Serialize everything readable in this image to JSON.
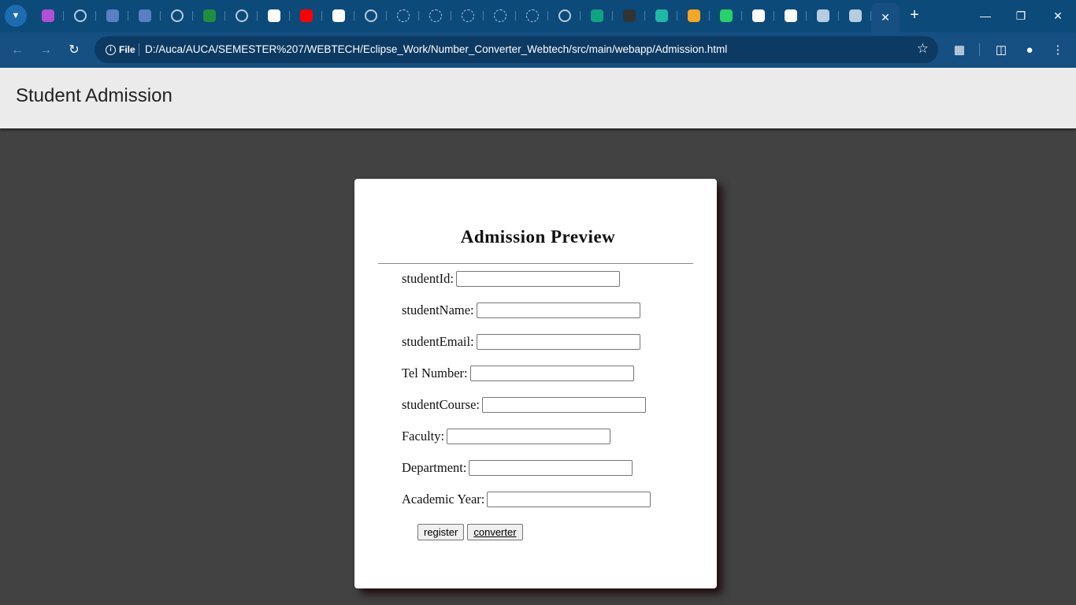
{
  "browser": {
    "tabs": [
      {
        "icon": "copilot-icon",
        "color": "#b14fd6"
      },
      {
        "icon": "web-icon",
        "color": "ring"
      },
      {
        "icon": "form-icon",
        "color": "#5a7fc4"
      },
      {
        "icon": "form-icon",
        "color": "#5a7fc4"
      },
      {
        "icon": "web-icon",
        "color": "ring"
      },
      {
        "icon": "classroom-icon",
        "color": "#1e8e3e"
      },
      {
        "icon": "loading-icon",
        "color": "ring"
      },
      {
        "icon": "chrome-icon",
        "color": "#ffffff"
      },
      {
        "icon": "youtube-icon",
        "color": "#ff0000"
      },
      {
        "icon": "github-icon",
        "color": "#ffffff"
      },
      {
        "icon": "web-icon",
        "color": "ring"
      },
      {
        "icon": "loading-icon",
        "color": "dash"
      },
      {
        "icon": "loading-icon",
        "color": "dash"
      },
      {
        "icon": "loading-icon",
        "color": "dash"
      },
      {
        "icon": "loading-icon",
        "color": "dash"
      },
      {
        "icon": "loading-icon",
        "color": "dash"
      },
      {
        "icon": "loading-icon",
        "color": "ring"
      },
      {
        "icon": "chatgpt-icon",
        "color": "#10a37f"
      },
      {
        "icon": "web-icon",
        "color": "#333333"
      },
      {
        "icon": "docs-icon",
        "color": "#1fb8a6"
      },
      {
        "icon": "search-icon",
        "color": "#f5a623"
      },
      {
        "icon": "whatsapp-icon",
        "color": "#25d366"
      },
      {
        "icon": "google-icon",
        "color": "#ffffff"
      },
      {
        "icon": "chrome-icon",
        "color": "#ffffff"
      },
      {
        "icon": "globe-icon",
        "color": "#b8cce0"
      },
      {
        "icon": "globe-icon",
        "color": "#b8cce0"
      }
    ],
    "site_chip_label": "File",
    "url": "D:/Auca/AUCA/SEMESTER%207/WEBTECH/Eclipse_Work/Number_Converter_Webtech/src/main/webapp/Admission.html",
    "colors": {
      "tabstrip": "#0c4a7a",
      "toolbar": "#164f82"
    }
  },
  "header": {
    "title": "Student Admission"
  },
  "form": {
    "heading": "Admission Preview",
    "fields": [
      {
        "label": "studentId:",
        "value": ""
      },
      {
        "label": "studentName:",
        "value": ""
      },
      {
        "label": "studentEmail:",
        "value": ""
      },
      {
        "label": "Tel Number:",
        "value": ""
      },
      {
        "label": "studentCourse:",
        "value": ""
      },
      {
        "label": "Faculty:",
        "value": ""
      },
      {
        "label": "Department:",
        "value": ""
      },
      {
        "label": "Academic Year:",
        "value": ""
      }
    ],
    "register_label": "register",
    "converter_label": "converter"
  }
}
